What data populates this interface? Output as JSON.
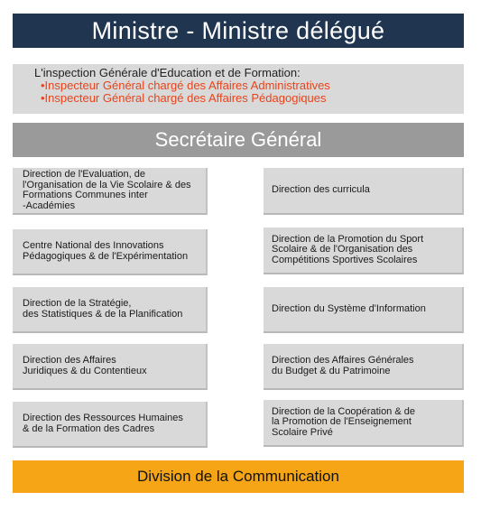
{
  "minister": "Ministre - Ministre délégué",
  "inspection": {
    "heading": "L'inspection Générale d'Education et de Formation:",
    "items": [
      "•Inspecteur Général chargé des Affaires Administratives",
      "•Inspecteur Général chargé des Affaires Pédagogiques"
    ]
  },
  "secretary": "Secrétaire Général",
  "left_directions": [
    "Direction de l'Evaluation, de\nl'Organisation de la Vie Scolaire & des\nFormations Communes inter\n-Académies",
    "Centre National des Innovations\nPédagogiques & de l'Expérimentation",
    "Direction de la Stratégie,\ndes Statistiques & de la Planification",
    "Direction des Affaires\nJuridiques & du Contentieux",
    "Direction des Ressources Humaines\n& de la Formation des Cadres"
  ],
  "right_directions": [
    "Direction des curricula",
    "Direction de la Promotion du Sport\nScolaire & de l'Organisation des\nCompétitions Sportives Scolaires",
    "Direction du Système d'Information",
    "Direction des Affaires Générales\ndu Budget & du Patrimoine",
    "Direction de la Coopération & de\nla Promotion de l'Enseignement\nScolaire Privé"
  ],
  "communication": "Division de la Communication",
  "colors": {
    "minister_bg": "#1f3550",
    "box_bg": "#d9d9d9",
    "secretary_bg": "#9a9a9a",
    "highlight_text": "#e8441b",
    "communication_bg": "#f5a515"
  }
}
